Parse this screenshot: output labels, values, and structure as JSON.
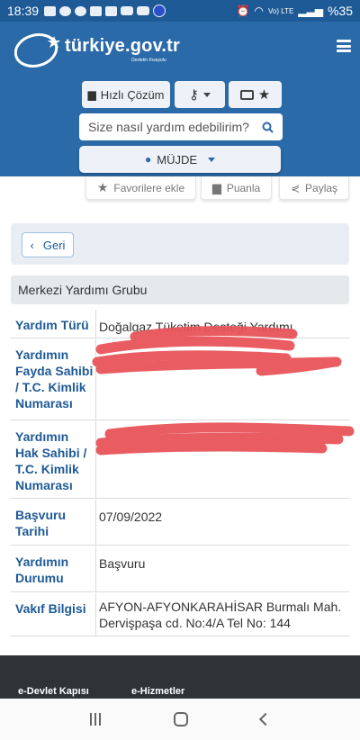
{
  "status_bar": {
    "time": "18:39",
    "network": "Vo) LTE",
    "battery": "%35"
  },
  "header": {
    "logo_text": "türkiye.gov.tr",
    "logo_tagline": "Devletin Kısayolu",
    "quick_solution_label": "Hızlı Çözüm",
    "search_placeholder": "Size nasıl yardım edebilirim?",
    "user_menu_label": "MÜJDE"
  },
  "actions": {
    "favorite_label": "Favorilere ekle",
    "rate_label": "Puanla",
    "share_label": "Paylaş"
  },
  "back_label": "Geri",
  "group_title": "Merkezi Yardımı Grubu",
  "details": [
    {
      "label": "Yardım Türü",
      "value": "Doğalgaz Tüketim Desteği Yardımı"
    },
    {
      "label": "Yardımın Fayda Sahibi / T.C. Kimlik Numarası",
      "value": ""
    },
    {
      "label": "Yardımın Hak Sahibi / T.C. Kimlik Numarası",
      "value": ""
    },
    {
      "label": "Başvuru Tarihi",
      "value": "07/09/2022"
    },
    {
      "label": "Yardımın Durumu",
      "value": "Başvuru"
    },
    {
      "label": "Vakıf Bilgisi",
      "value": "AFYON-AFYONKARAHİSAR Burmalı Mah. Dervişpaşa cd. No:4/A Tel No: 144"
    }
  ],
  "footer": {
    "col1": "e-Devlet Kapısı",
    "col2": "e-Hizmetler"
  },
  "colors": {
    "header_bg": "#2a6aa8",
    "label_blue": "#1e5a96",
    "redaction": "#e8555a",
    "footer_bg": "#2f3338"
  },
  "icons": [
    "chat-icon",
    "key-icon",
    "id-card-icon",
    "star-icon",
    "search-icon",
    "user-icon",
    "comment-icon",
    "share-icon",
    "chevron-left-icon"
  ]
}
